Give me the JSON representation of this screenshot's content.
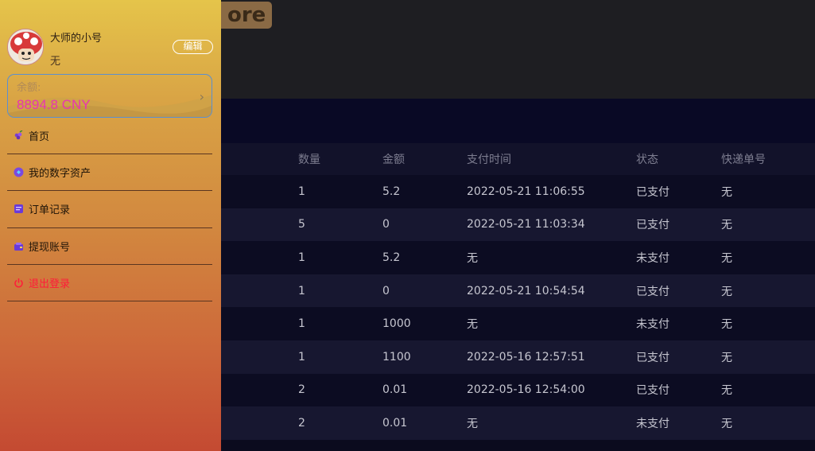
{
  "store_logo_text": "ore",
  "drawer": {
    "user_name": "大师的小号",
    "user_signature": "无",
    "edit_label": "编辑",
    "balance_label": "余额:",
    "balance_value": "8894.8 CNY",
    "balance_arrow": "›",
    "menu": [
      {
        "label": "首页",
        "icon": "grape-icon"
      },
      {
        "label": "我的数字资产",
        "icon": "asset-icon"
      },
      {
        "label": "订单记录",
        "icon": "order-icon"
      },
      {
        "label": "提现账号",
        "icon": "wallet-icon"
      },
      {
        "label": "退出登录",
        "icon": "power-icon"
      }
    ]
  },
  "orders": {
    "columns": [
      "数量",
      "金额",
      "支付时间",
      "状态",
      "快递单号"
    ],
    "rows": [
      {
        "qty": "1",
        "amount": "5.2",
        "time": "2022-05-21 11:06:55",
        "status": "已支付",
        "tracking": "无"
      },
      {
        "qty": "5",
        "amount": "0",
        "time": "2022-05-21 11:03:34",
        "status": "已支付",
        "tracking": "无"
      },
      {
        "qty": "1",
        "amount": "5.2",
        "time": "无",
        "status": "未支付",
        "tracking": "无"
      },
      {
        "qty": "1",
        "amount": "0",
        "time": "2022-05-21 10:54:54",
        "status": "已支付",
        "tracking": "无"
      },
      {
        "qty": "1",
        "amount": "1000",
        "time": "无",
        "status": "未支付",
        "tracking": "无"
      },
      {
        "qty": "1",
        "amount": "1100",
        "time": "2022-05-16 12:57:51",
        "status": "已支付",
        "tracking": "无"
      },
      {
        "qty": "2",
        "amount": "0.01",
        "time": "2022-05-16 12:54:00",
        "status": "已支付",
        "tracking": "无"
      },
      {
        "qty": "2",
        "amount": "0.01",
        "time": "无",
        "status": "未支付",
        "tracking": "无"
      }
    ]
  },
  "colors": {
    "drawer_top": "#e5c44a",
    "drawer_bottom": "#c44a32",
    "balance_value": "#e835b0",
    "logout": "#ff1a3a"
  }
}
